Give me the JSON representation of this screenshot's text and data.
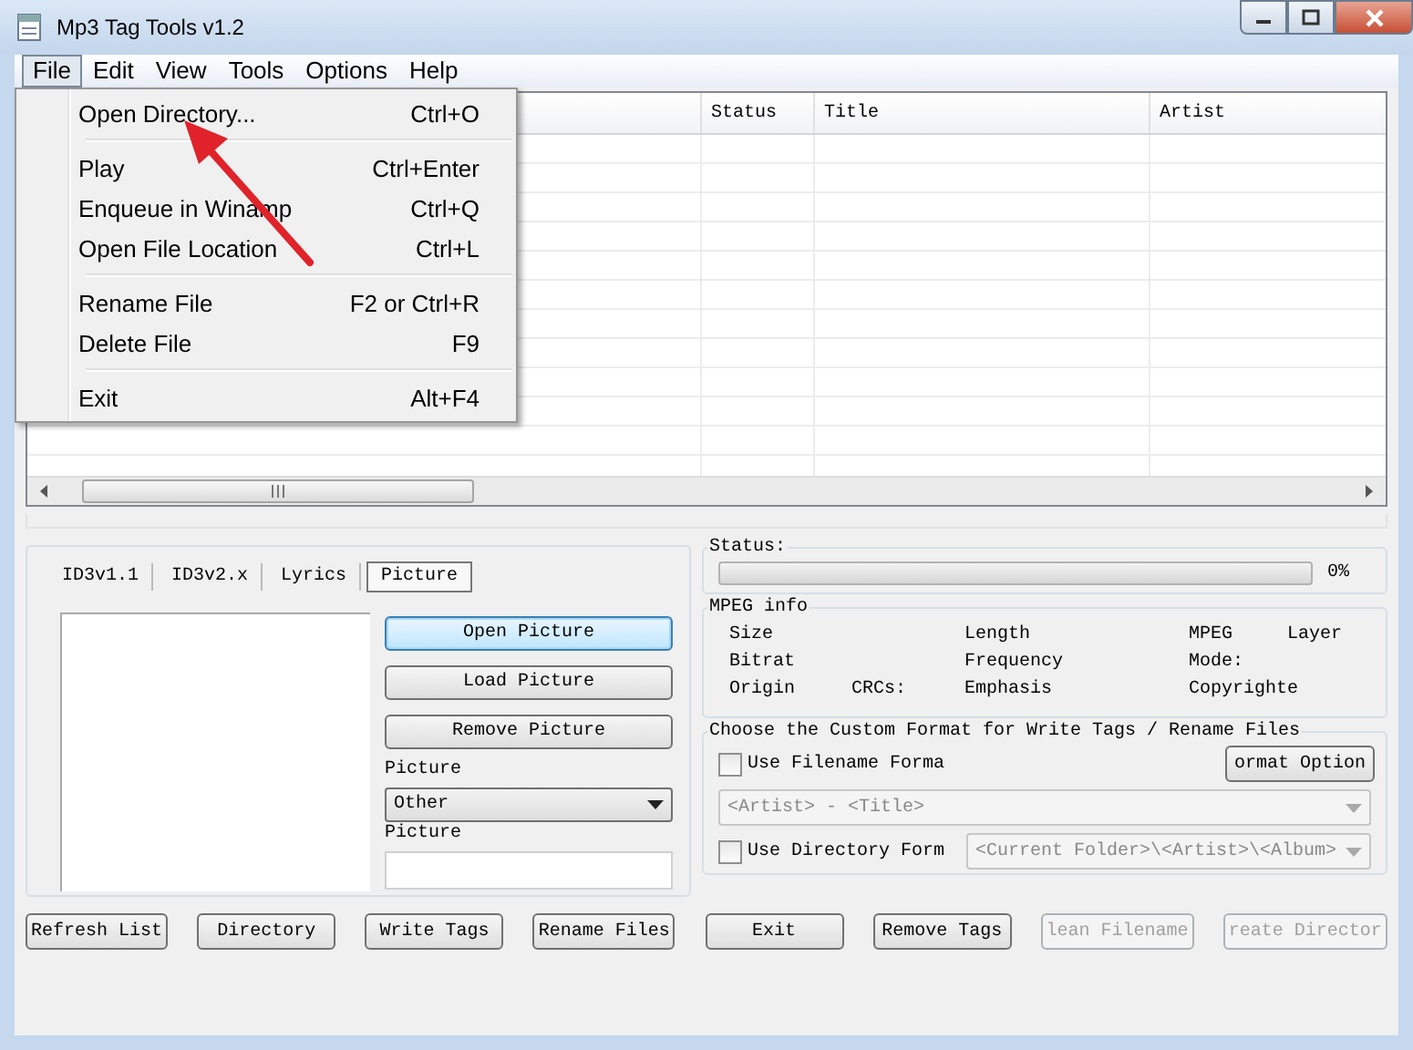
{
  "window": {
    "title": "Mp3 Tag Tools v1.2"
  },
  "menu_bar": [
    {
      "label": "File",
      "selected": true
    },
    {
      "label": "Edit",
      "selected": false
    },
    {
      "label": "View",
      "selected": false
    },
    {
      "label": "Tools",
      "selected": false
    },
    {
      "label": "Options",
      "selected": false
    },
    {
      "label": "Help",
      "selected": false
    }
  ],
  "file_menu": [
    [
      {
        "label": "Open Directory...",
        "shortcut": "Ctrl+O"
      }
    ],
    [
      {
        "label": "Play",
        "shortcut": "Ctrl+Enter"
      },
      {
        "label": "Enqueue in Winamp",
        "shortcut": "Ctrl+Q"
      },
      {
        "label": "Open File Location",
        "shortcut": "Ctrl+L"
      }
    ],
    [
      {
        "label": "Rename File",
        "shortcut": "F2 or Ctrl+R"
      },
      {
        "label": "Delete File",
        "shortcut": "F9"
      }
    ],
    [
      {
        "label": "Exit",
        "shortcut": "Alt+F4"
      }
    ]
  ],
  "file_list": {
    "columns": [
      "Status",
      "Title",
      "Artist"
    ]
  },
  "tag_tabs": [
    {
      "label": "ID3v1.1",
      "selected": false
    },
    {
      "label": "ID3v2.x",
      "selected": false
    },
    {
      "label": "Lyrics",
      "selected": false
    },
    {
      "label": "Picture",
      "selected": true
    }
  ],
  "picture_panel": {
    "buttons": [
      {
        "label": "Open Picture",
        "focused": true
      },
      {
        "label": "Load Picture",
        "focused": false
      },
      {
        "label": "Remove Picture",
        "focused": false
      }
    ],
    "type_label": "Picture",
    "type_value": "Other",
    "description_label": "Picture"
  },
  "status": {
    "title": "Status:",
    "level": 0,
    "reading": "0%"
  },
  "mpeg_info": {
    "title": "MPEG info",
    "rows": [
      {
        "column_1": "Size",
        "column_3": "Length",
        "column_4": "MPEG",
        "column_5": "Layer"
      },
      {
        "column_1": "Bitrat",
        "column_3": "Frequency",
        "column_4": "Mode:"
      },
      {
        "column_1": "Origin",
        "column_2": "CRCs:",
        "column_3": "Emphasis",
        "column_4": "Copyrighte"
      }
    ]
  },
  "custom_format": {
    "title": "Choose the Custom Format for Write Tags / Rename Files",
    "filename_format": {
      "label": "Use Filename Forma",
      "checked": false
    },
    "format_options": "ormat Option",
    "filename_pattern": {
      "value": "<Artist> - <Title>",
      "disabled": true
    },
    "directory_format": {
      "label": "Use Directory Form",
      "checked": false
    },
    "directory_pattern": {
      "value": "<Current Folder>\\<Artist>\\<Album>",
      "disabled": true
    }
  },
  "buttons": [
    {
      "label": "Refresh List",
      "disabled": false
    },
    {
      "label": "Directory",
      "disabled": false
    },
    {
      "label": "Write Tags",
      "disabled": false
    },
    {
      "label": "Rename Files",
      "disabled": false
    },
    {
      "label": "Exit",
      "disabled": false
    },
    {
      "label": "Remove Tags",
      "disabled": false
    },
    {
      "label": "lean Filename",
      "disabled": true
    },
    {
      "label": "reate Director",
      "disabled": true
    }
  ]
}
